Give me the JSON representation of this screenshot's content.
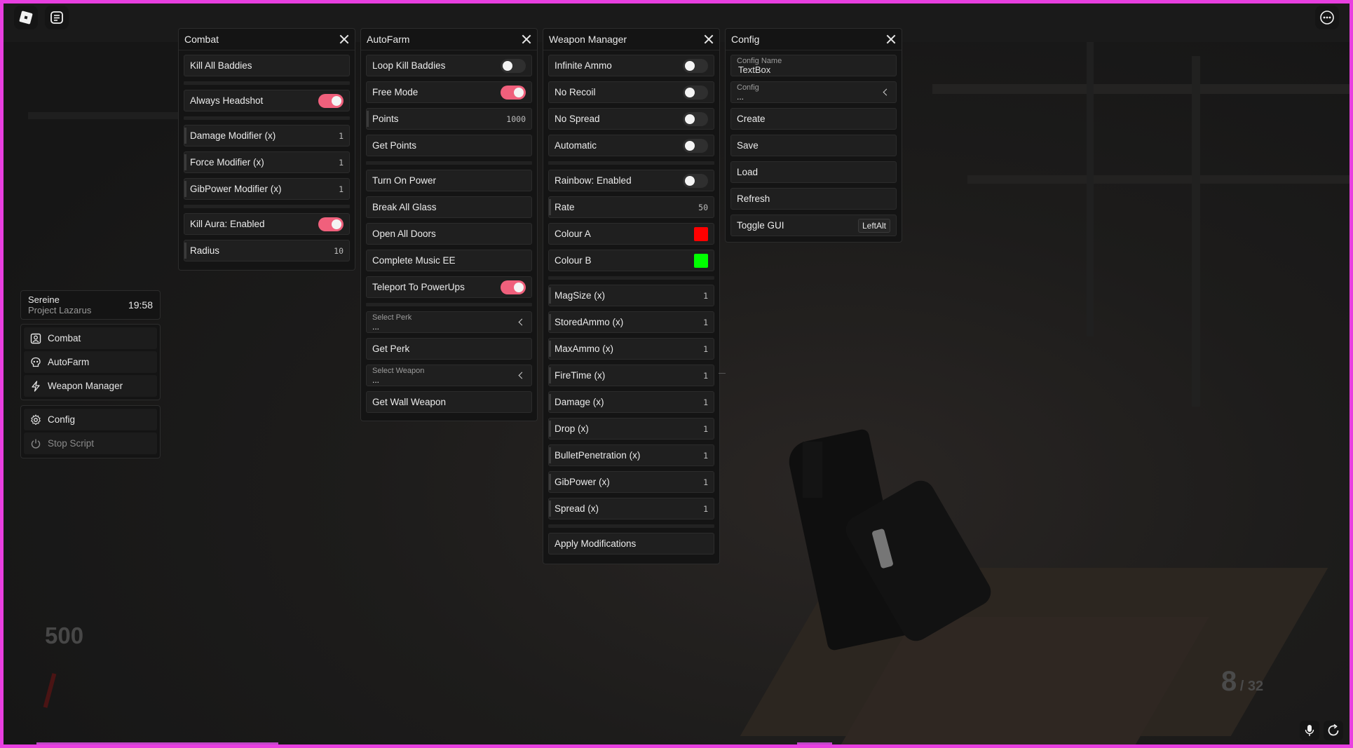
{
  "panels": {
    "combat": {
      "title": "Combat",
      "kill_all": "Kill All Baddies",
      "always_headshot": "Always Headshot",
      "damage_modifier": {
        "label": "Damage Modifier (x)",
        "value": "1"
      },
      "force_modifier": {
        "label": "Force Modifier (x)",
        "value": "1"
      },
      "gibpower_modifier": {
        "label": "GibPower Modifier (x)",
        "value": "1"
      },
      "kill_aura": "Kill Aura: Enabled",
      "radius": {
        "label": "Radius",
        "value": "10"
      }
    },
    "autofarm": {
      "title": "AutoFarm",
      "loop_kill": "Loop Kill Baddies",
      "free_mode": "Free Mode",
      "points": {
        "label": "Points",
        "value": "1000"
      },
      "get_points": "Get Points",
      "turn_on_power": "Turn On Power",
      "break_glass": "Break All Glass",
      "open_doors": "Open All Doors",
      "complete_music": "Complete Music EE",
      "teleport_powerups": "Teleport To PowerUps",
      "select_perk": {
        "label": "Select Perk",
        "value": "..."
      },
      "get_perk": "Get Perk",
      "select_weapon": {
        "label": "Select Weapon",
        "value": "..."
      },
      "get_wall_weapon": "Get Wall Weapon"
    },
    "weapon": {
      "title": "Weapon Manager",
      "infinite_ammo": "Infinite Ammo",
      "no_recoil": "No Recoil",
      "no_spread": "No Spread",
      "automatic": "Automatic",
      "rainbow": "Rainbow: Enabled",
      "rate": {
        "label": "Rate",
        "value": "50"
      },
      "colour_a": {
        "label": "Colour A",
        "color": "#ff0000"
      },
      "colour_b": {
        "label": "Colour B",
        "color": "#00ff00"
      },
      "mods": [
        {
          "label": "MagSize (x)",
          "value": "1"
        },
        {
          "label": "StoredAmmo (x)",
          "value": "1"
        },
        {
          "label": "MaxAmmo (x)",
          "value": "1"
        },
        {
          "label": "FireTime (x)",
          "value": "1"
        },
        {
          "label": "Damage (x)",
          "value": "1"
        },
        {
          "label": "Drop (x)",
          "value": "1"
        },
        {
          "label": "BulletPenetration (x)",
          "value": "1"
        },
        {
          "label": "GibPower (x)",
          "value": "1"
        },
        {
          "label": "Spread (x)",
          "value": "1"
        }
      ],
      "apply": "Apply Modifications"
    },
    "config": {
      "title": "Config",
      "config_name": {
        "label": "Config Name",
        "value": "TextBox"
      },
      "config_select": {
        "label": "Config",
        "value": "..."
      },
      "create": "Create",
      "save": "Save",
      "load": "Load",
      "refresh": "Refresh",
      "toggle_gui": {
        "label": "Toggle GUI",
        "key": "LeftAlt"
      }
    }
  },
  "toggles": {
    "always_headshot": true,
    "kill_aura": true,
    "loop_kill": false,
    "free_mode": true,
    "teleport_powerups": true,
    "infinite_ammo": false,
    "no_recoil": false,
    "no_spread": false,
    "automatic": false,
    "rainbow": false
  },
  "sidebar": {
    "user": "Sereine",
    "project": "Project Lazarus",
    "time": "19:58",
    "nav": [
      "Combat",
      "AutoFarm",
      "Weapon Manager"
    ],
    "config": "Config",
    "stop": "Stop Script"
  },
  "hud": {
    "score": "500",
    "ammo": "8",
    "reserve": "/ 32"
  },
  "colors": {
    "accent": "#f0607c",
    "frame": "#e83fe0"
  }
}
